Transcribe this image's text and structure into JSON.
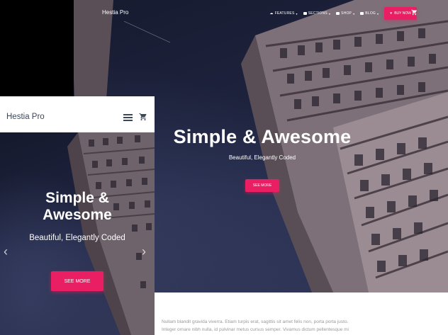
{
  "desktop": {
    "brand": "Hestia Pro",
    "menu": [
      {
        "label": "FEATURES",
        "icon": "cloud-icon"
      },
      {
        "label": "SECTIONS",
        "icon": "sections-icon"
      },
      {
        "label": "SHOP",
        "icon": "shop-icon"
      },
      {
        "label": "BLOG",
        "icon": "blog-icon"
      }
    ],
    "buy_label": "BUY NOW",
    "cart_icon": "cart-icon",
    "title": "Simple & Awesome",
    "subtitle": "Beautiful, Elegantly Coded",
    "button": "SEE MORE",
    "paragraph_line1": "Nullam blandit gravida viverra. Etiam turpis erat, sagittis sit amet felis non, porta porta justo.",
    "paragraph_line2": "Integer ornare nibh nulla, id pulvinar metus cursus semper. Vivamus dictum pellentesque mi"
  },
  "mobile": {
    "brand": "Hestia Pro",
    "menu_icon": "hamburger-icon",
    "cart_icon": "cart-icon",
    "title_line1": "Simple &",
    "title_line2": "Awesome",
    "subtitle": "Beautiful, Elegantly Coded",
    "button": "SEE MORE",
    "prev_arrow": "‹",
    "next_arrow": "›"
  },
  "colors": {
    "accent": "#e91e63",
    "sky": "#1f2440",
    "text_dark": "#3c4858"
  }
}
